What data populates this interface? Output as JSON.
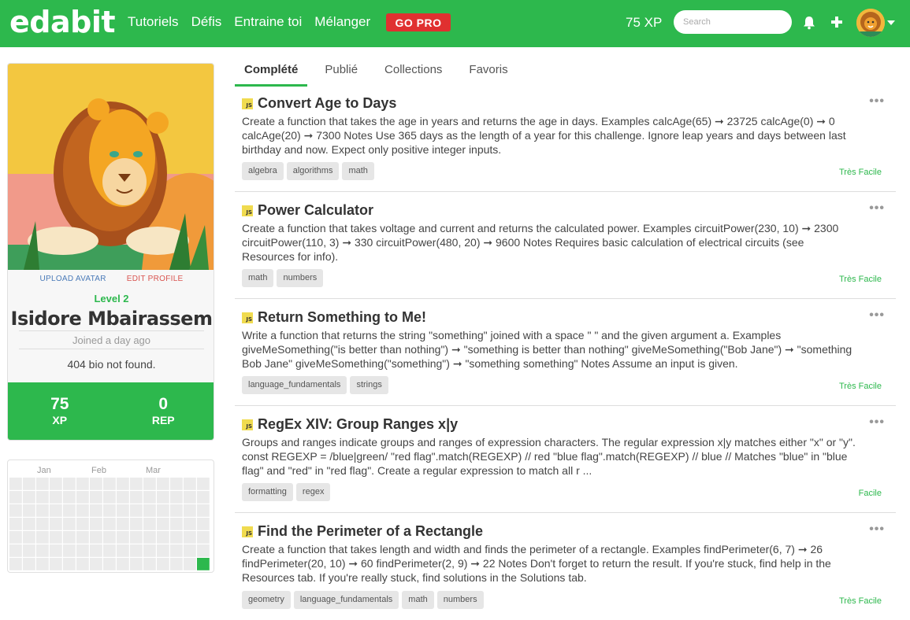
{
  "nav": {
    "logo": "edabit",
    "links": [
      "Tutoriels",
      "Défis",
      "Entraine toi",
      "Mélanger"
    ],
    "gopro": "GO PRO",
    "xp": "75 XP",
    "search_placeholder": "Search"
  },
  "profile": {
    "upload_avatar": "UPLOAD AVATAR",
    "edit_profile": "EDIT PROFILE",
    "level": "Level 2",
    "name": "Isidore Mbairassem",
    "joined": "Joined a day ago",
    "bio": "404 bio not found.",
    "xp_value": "75",
    "xp_label": "XP",
    "rep_value": "0",
    "rep_label": "REP"
  },
  "heatmap": {
    "months": [
      "Jan",
      "Feb",
      "Mar"
    ]
  },
  "tabs": [
    "Complété",
    "Publié",
    "Collections",
    "Favoris"
  ],
  "challenges": [
    {
      "badge": "JS",
      "title": "Convert Age to Days",
      "desc": "Create a function that takes the age in years and returns the age in days. Examples calcAge(65) ➞ 23725 calcAge(0) ➞ 0 calcAge(20) ➞ 7300 Notes Use 365 days as the length of a year for this challenge. Ignore leap years and days between last birthday and now. Expect only positive integer inputs.",
      "tags": [
        "algebra",
        "algorithms",
        "math"
      ],
      "difficulty": "Très Facile"
    },
    {
      "badge": "JS",
      "title": "Power Calculator",
      "desc": "Create a function that takes voltage and current and returns the calculated power. Examples circuitPower(230, 10) ➞ 2300 circuitPower(110, 3) ➞ 330 circuitPower(480, 20) ➞ 9600 Notes Requires basic calculation of electrical circuits (see Resources for info).",
      "tags": [
        "math",
        "numbers"
      ],
      "difficulty": "Très Facile"
    },
    {
      "badge": "JS",
      "title": "Return Something to Me!",
      "desc": "Write a function that returns the string \"something\" joined with a space \" \" and the given argument a. Examples giveMeSomething(\"is better than nothing\") ➞ \"something is better than nothing\" giveMeSomething(\"Bob Jane\") ➞ \"something Bob Jane\" giveMeSomething(\"something\") ➞ \"something something\" Notes Assume an input is given.",
      "tags": [
        "language_fundamentals",
        "strings"
      ],
      "difficulty": "Très Facile"
    },
    {
      "badge": "JS",
      "title": "RegEx XIV: Group Ranges x|y",
      "desc": "Groups and ranges indicate groups and ranges of expression characters. The regular expression x|y matches either \"x\" or \"y\". const REGEXP = /blue|green/ \"red flag\".match(REGEXP) // red \"blue flag\".match(REGEXP) // blue // Matches \"blue\" in \"blue flag\" and \"red\" in \"red flag\". Create a regular expression to match all r ...",
      "tags": [
        "formatting",
        "regex"
      ],
      "difficulty": "Facile"
    },
    {
      "badge": "JS",
      "title": "Find the Perimeter of a Rectangle",
      "desc": "Create a function that takes length and width and finds the perimeter of a rectangle. Examples findPerimeter(6, 7) ➞ 26 findPerimeter(20, 10) ➞ 60 findPerimeter(2, 9) ➞ 22 Notes Don't forget to return the result. If you're stuck, find help in the Resources tab. If you're really stuck, find solutions in the Solutions tab.",
      "tags": [
        "geometry",
        "language_fundamentals",
        "math",
        "numbers"
      ],
      "difficulty": "Très Facile"
    }
  ],
  "colors": {
    "brand_green": "#2db84d",
    "pro_red": "#e03030",
    "js_yellow": "#f0db4f"
  }
}
